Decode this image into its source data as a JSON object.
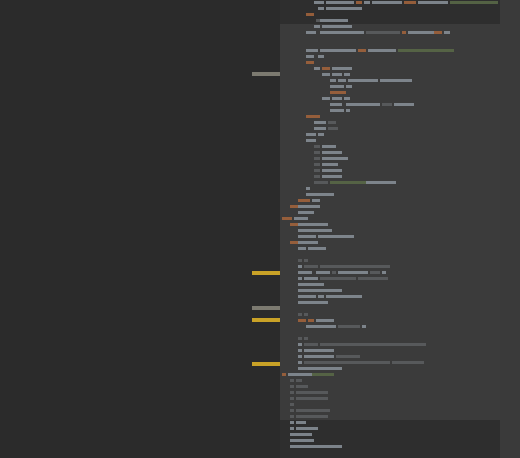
{
  "colors": {
    "editor_bg": "#2b2b2b",
    "minimap_bg": "#2e2e2e",
    "viewport_bg": "#3b3b3b",
    "scrollbar_bg": "#3a3a3a",
    "marker_warning": "#c9a227",
    "marker_info": "#7c7a70",
    "token_default": "#8a929a",
    "token_keyword": "#a6653c",
    "token_string": "#5a6b48",
    "token_comment": "#5d5f61"
  },
  "gutter_markers": [
    {
      "kind": "info"
    },
    {
      "kind": "warning"
    },
    {
      "kind": "info"
    },
    {
      "kind": "warning"
    },
    {
      "kind": "warning"
    }
  ]
}
